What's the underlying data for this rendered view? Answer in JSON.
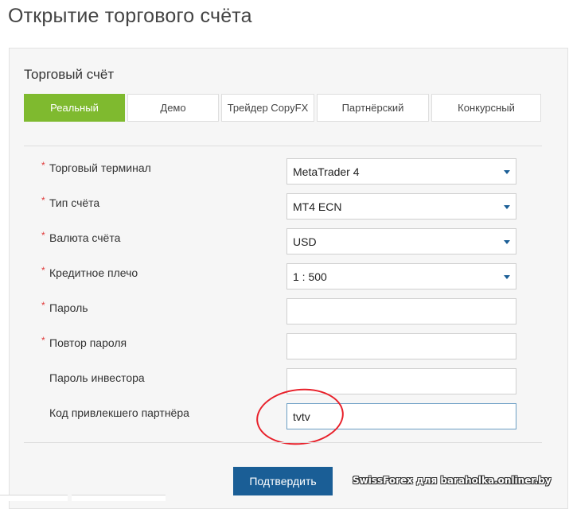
{
  "page_title": "Открытие торгового счёта",
  "section_title": "Торговый счёт",
  "tabs": [
    {
      "label": "Реальный",
      "active": true
    },
    {
      "label": "Демо",
      "active": false
    },
    {
      "label": "Трейдер CopyFX",
      "active": false
    },
    {
      "label": "Партнёрский",
      "active": false
    },
    {
      "label": "Конкурсный",
      "active": false
    }
  ],
  "fields": {
    "terminal": {
      "label": "Торговый терминал",
      "required": true,
      "value": "MetaTrader 4"
    },
    "account_type": {
      "label": "Тип счёта",
      "required": true,
      "value": "MT4 ECN"
    },
    "currency": {
      "label": "Валюта счёта",
      "required": true,
      "value": "USD"
    },
    "leverage": {
      "label": "Кредитное плечо",
      "required": true,
      "value": "1 : 500"
    },
    "password": {
      "label": "Пароль",
      "required": true,
      "value": ""
    },
    "password_repeat": {
      "label": "Повтор пароля",
      "required": true,
      "value": ""
    },
    "investor_password": {
      "label": "Пароль инвестора",
      "required": false,
      "value": ""
    },
    "partner_code": {
      "label": "Код привлекшего партнёра",
      "required": false,
      "value": "tvtv"
    }
  },
  "required_mark": "*",
  "submit_label": "Подтвердить",
  "watermark": "SwissForex для baraholka.onliner.by",
  "colors": {
    "tab_active": "#7fba2f",
    "button": "#1a5e96",
    "required": "#e03a3a",
    "annotation": "#e8202a"
  }
}
